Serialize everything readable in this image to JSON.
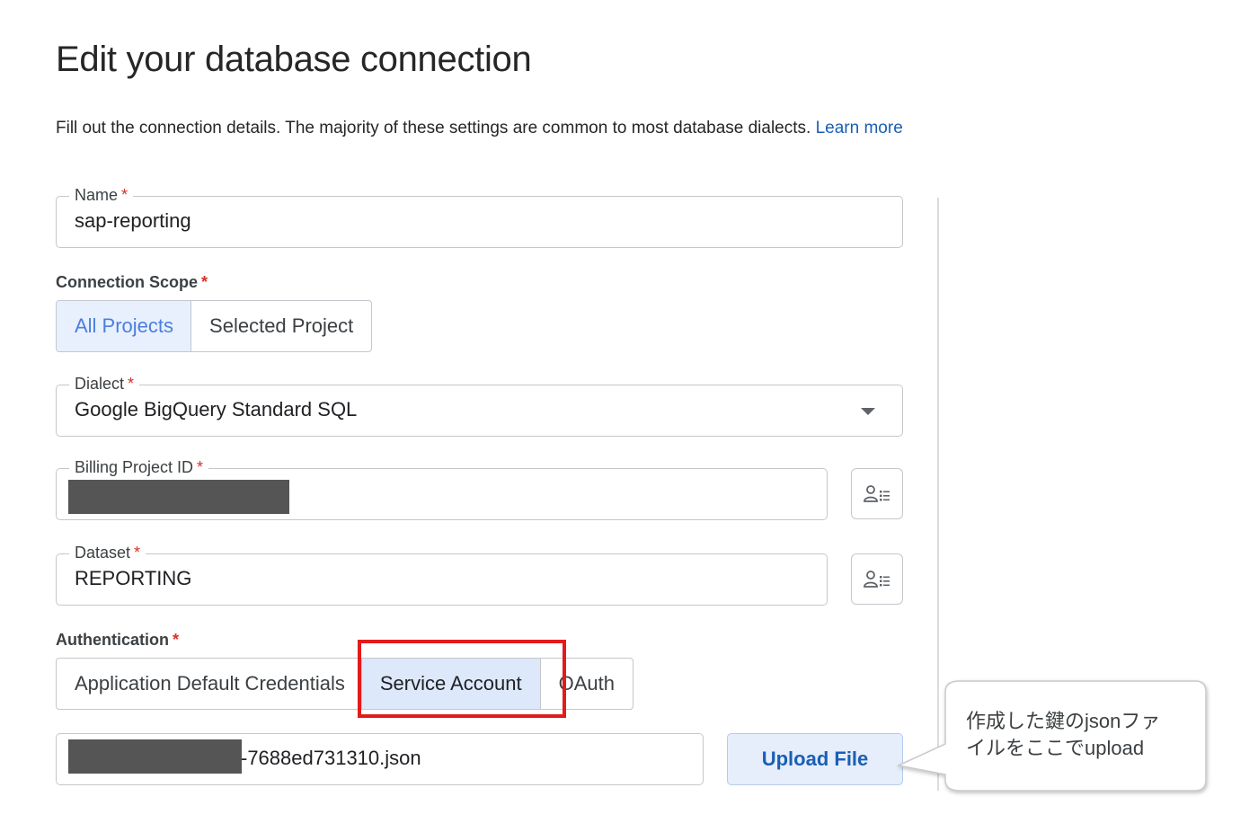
{
  "page": {
    "title": "Edit your database connection",
    "intro_text": "Fill out the connection details. The majority of these settings are common to most database dialects.",
    "learn_more": "Learn more"
  },
  "fields": {
    "name": {
      "label": "Name",
      "required": "*",
      "value": "sap-reporting"
    },
    "dialect": {
      "label": "Dialect",
      "required": "*",
      "value": "Google BigQuery Standard SQL"
    },
    "billing_project_id": {
      "label": "Billing Project ID",
      "required": "*",
      "value": ""
    },
    "dataset": {
      "label": "Dataset",
      "required": "*",
      "value": "REPORTING"
    },
    "key_file": {
      "value": "-7688ed731310.json"
    }
  },
  "connection_scope": {
    "label": "Connection Scope",
    "required": "*",
    "options": [
      "All Projects",
      "Selected Project"
    ],
    "selected": "All Projects"
  },
  "authentication": {
    "label": "Authentication",
    "required": "*",
    "options": [
      "Application Default Credentials",
      "Service Account",
      "OAuth"
    ],
    "selected": "Service Account"
  },
  "upload_button": "Upload File",
  "callout": {
    "line1": "作成した鍵のjsonファ",
    "line2": "イルをここでupload"
  },
  "colors": {
    "accent": "#1a5fb4",
    "required": "#d93025",
    "highlight": "#e21b1b",
    "selected_bg": "#e8f0fe"
  },
  "icons": {
    "dialect_dropdown": "chevron-down-icon",
    "picker": "person-list-icon"
  }
}
